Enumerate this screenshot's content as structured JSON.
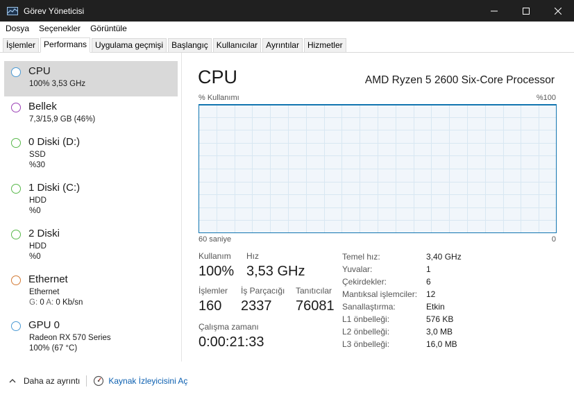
{
  "window": {
    "title": "Görev Yöneticisi"
  },
  "menu": [
    "Dosya",
    "Seçenekler",
    "Görüntüle"
  ],
  "tabs": [
    "İşlemler",
    "Performans",
    "Uygulama geçmişi",
    "Başlangıç",
    "Kullanıcılar",
    "Ayrıntılar",
    "Hizmetler"
  ],
  "sidebar": {
    "items": [
      {
        "title": "CPU",
        "line1": "100% 3,53 GHz",
        "line2": "",
        "color": "#4a9ad4"
      },
      {
        "title": "Bellek",
        "line1": "7,3/15,9 GB (46%)",
        "line2": "",
        "color": "#9b3fb5"
      },
      {
        "title": "0 Diski (D:)",
        "line1": "SSD",
        "line2": "%30",
        "color": "#58b84a"
      },
      {
        "title": "1 Diski (C:)",
        "line1": "HDD",
        "line2": "%0",
        "color": "#58b84a"
      },
      {
        "title": "2 Diski",
        "line1": "HDD",
        "line2": "%0",
        "color": "#58b84a"
      },
      {
        "title": "Ethernet",
        "line1": "Ethernet",
        "line2_label_g": "G:",
        "line2_g": "0",
        "line2_label_a": "A:",
        "line2_a": "0 Kb/sn",
        "color": "#d37a34"
      },
      {
        "title": "GPU 0",
        "line1": "Radeon RX 570 Series",
        "line2": "100%  (67 °C)",
        "color": "#4a9ad4"
      }
    ]
  },
  "main": {
    "title": "CPU",
    "processor": "AMD Ryzen 5 2600 Six-Core Processor",
    "graph_label": "% Kullanımı",
    "graph_max": "%100",
    "axis_left": "60 saniye",
    "axis_right": "0",
    "graph_utilization": 100,
    "stats": {
      "usage_label": "Kullanım",
      "usage_value": "100%",
      "speed_label": "Hız",
      "speed_value": "3,53 GHz",
      "processes_label": "İşlemler",
      "processes_value": "160",
      "threads_label": "İş Parçacığı",
      "threads_value": "2337",
      "handles_label": "Tanıtıcılar",
      "handles_value": "76081",
      "uptime_label": "Çalışma zamanı",
      "uptime_value": "0:00:21:33"
    },
    "info": [
      {
        "label": "Temel hız:",
        "value": "3,40 GHz"
      },
      {
        "label": "Yuvalar:",
        "value": "1"
      },
      {
        "label": "Çekirdekler:",
        "value": "6"
      },
      {
        "label": "Mantıksal işlemciler:",
        "value": "12"
      },
      {
        "label": "Sanallaştırma:",
        "value": "Etkin"
      },
      {
        "label": "L1 önbelleği:",
        "value": "576 KB"
      },
      {
        "label": "L2 önbelleği:",
        "value": "3,0 MB"
      },
      {
        "label": "L3 önbelleği:",
        "value": "16,0 MB"
      }
    ]
  },
  "footer": {
    "less_details": "Daha az ayrıntı",
    "resource_monitor": "Kaynak İzleyicisini Aç"
  },
  "colors": {
    "titlebar": "#202020",
    "graph_border": "#1175b0",
    "graph_grid": "#d8e7f2",
    "graph_fill": "#f1f6fb",
    "link": "#0b5fb0"
  }
}
